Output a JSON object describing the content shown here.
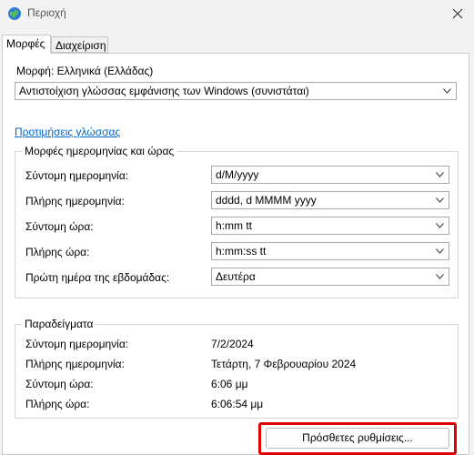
{
  "window": {
    "title": "Περιοχή",
    "app_icon": "globe-icon",
    "close_icon": "close-icon"
  },
  "tabs": [
    {
      "label": "Μορφές",
      "active": true
    },
    {
      "label": "Διαχείριση",
      "active": false
    }
  ],
  "format": {
    "label": "Μορφή: Ελληνικά (Ελλάδας)",
    "selected": "Αντιστοίχιση γλώσσας εμφάνισης των Windows (συνιστάται)"
  },
  "language_prefs_link": "Προτιμήσεις γλώσσας",
  "datetime_group": {
    "title": "Μορφές ημερομηνίας και ώρας",
    "rows": [
      {
        "label": "Σύντομη ημερομηνία:",
        "value": "d/M/yyyy"
      },
      {
        "label": "Πλήρης ημερομηνία:",
        "value": "dddd, d MMMM yyyy"
      },
      {
        "label": "Σύντομη ώρα:",
        "value": "h:mm tt"
      },
      {
        "label": "Πλήρης ώρα:",
        "value": "h:mm:ss tt"
      },
      {
        "label": "Πρώτη ημέρα της εβδομάδας:",
        "value": "Δευτέρα"
      }
    ]
  },
  "examples_group": {
    "title": "Παραδείγματα",
    "rows": [
      {
        "label": "Σύντομη ημερομηνία:",
        "value": "7/2/2024"
      },
      {
        "label": "Πλήρης ημερομηνία:",
        "value": "Τετάρτη, 7 Φεβρουαρίου 2024"
      },
      {
        "label": "Σύντομη ώρα:",
        "value": "6:06 μμ"
      },
      {
        "label": "Πλήρης ώρα:",
        "value": "6:06:54 μμ"
      }
    ]
  },
  "additional_settings_button": "Πρόσθετες ρυθμίσεις...",
  "colors": {
    "accent": "#0066cc",
    "highlight": "#e00000"
  }
}
